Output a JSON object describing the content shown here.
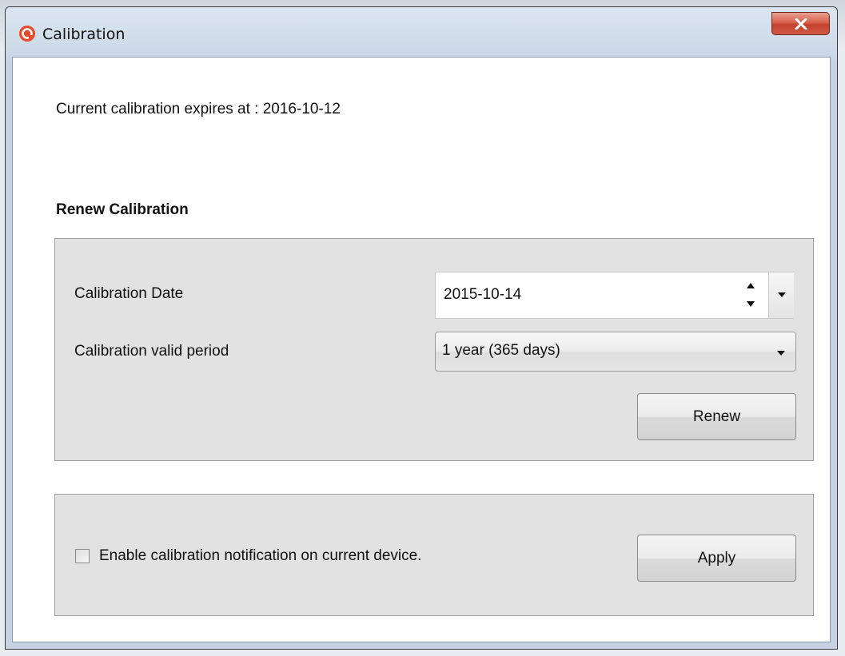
{
  "window": {
    "title": "Calibration"
  },
  "status": {
    "expires_text": "Current calibration expires at : 2016-10-12"
  },
  "renew": {
    "heading": "Renew Calibration",
    "date_label": "Calibration Date",
    "date_value": "2015-10-14",
    "period_label": "Calibration valid period",
    "period_value": "1 year (365 days)",
    "renew_button": "Renew"
  },
  "notification": {
    "checkbox_label": "Enable calibration notification on current device.",
    "checked": false,
    "apply_button": "Apply"
  },
  "icons": {
    "app": "app-logo-icon",
    "close": "close-icon",
    "spin": "spin-updown-icon",
    "dropdown": "chevron-down-icon"
  },
  "colors": {
    "app_icon": "#e84a2a",
    "close_button": "#d35a45"
  }
}
